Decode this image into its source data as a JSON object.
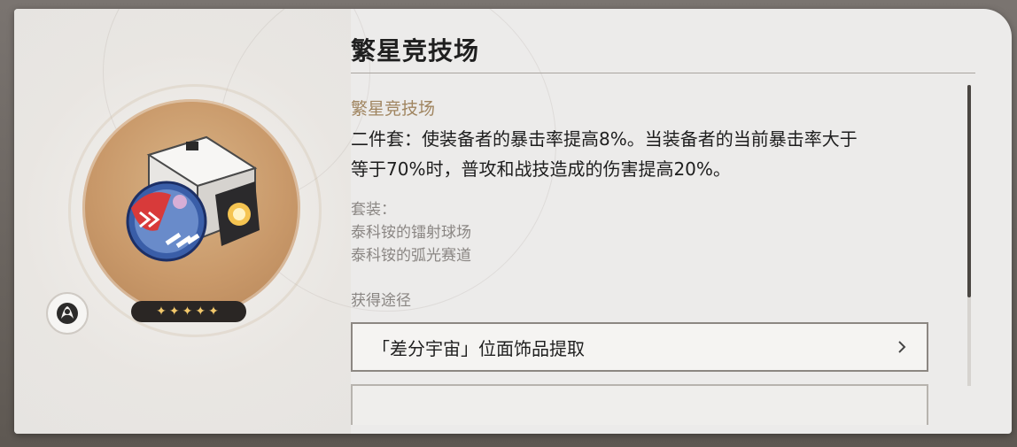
{
  "relic": {
    "title": "繁星竞技场",
    "set_name": "繁星竞技场",
    "effect_lines": [
      "二件套：使装备者的暴击率提高8%。当装备者的当前暴击率大于",
      "等于70%时，普攻和战技造成的伤害提高20%。"
    ],
    "rarity_stars": "✦✦✦✦✦",
    "set_pieces_label": "套装：",
    "set_pieces": [
      "泰科铵的镭射球场",
      "泰科铵的弧光赛道"
    ],
    "obtain_label": "获得途径",
    "sources": [
      "「差分宇宙」位面饰品提取"
    ]
  },
  "icons": {
    "path_icon": "destruction-path-icon",
    "chevron": "chevron-right-icon"
  },
  "colors": {
    "set_name": "#a08560",
    "star": "#f2c86b",
    "art_background": "#c9996a"
  }
}
